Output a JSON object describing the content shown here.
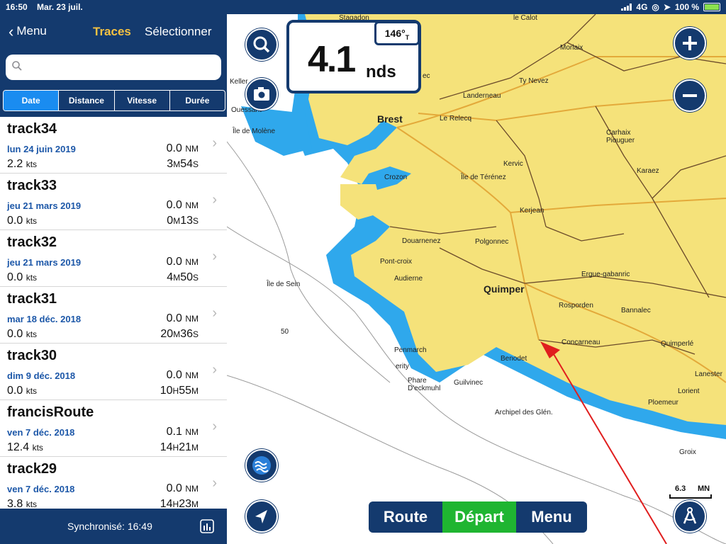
{
  "status_bar": {
    "time": "16:50",
    "date": "Mar. 23 juil.",
    "network": "4G",
    "battery": "100 %"
  },
  "nav": {
    "back_label": "Menu",
    "title": "Traces",
    "select_label": "Sélectionner"
  },
  "search": {
    "value": "",
    "placeholder": ""
  },
  "sort_tabs": [
    {
      "label": "Date",
      "active": true
    },
    {
      "label": "Distance",
      "active": false
    },
    {
      "label": "Vitesse",
      "active": false
    },
    {
      "label": "Durée",
      "active": false
    }
  ],
  "tracks": [
    {
      "name": "track34",
      "date": "lun 24 juin 2019",
      "dist": "0.0",
      "dist_unit": "NM",
      "speed": "2.2",
      "speed_unit": "kts",
      "dur_a": "3",
      "dur_a_unit": "M",
      "dur_b": "54",
      "dur_b_unit": "S"
    },
    {
      "name": "track33",
      "date": "jeu 21 mars 2019",
      "dist": "0.0",
      "dist_unit": "NM",
      "speed": "0.0",
      "speed_unit": "kts",
      "dur_a": "0",
      "dur_a_unit": "M",
      "dur_b": "13",
      "dur_b_unit": "S"
    },
    {
      "name": "track32",
      "date": "jeu 21 mars 2019",
      "dist": "0.0",
      "dist_unit": "NM",
      "speed": "0.0",
      "speed_unit": "kts",
      "dur_a": "4",
      "dur_a_unit": "M",
      "dur_b": "50",
      "dur_b_unit": "S"
    },
    {
      "name": "track31",
      "date": "mar 18 déc. 2018",
      "dist": "0.0",
      "dist_unit": "NM",
      "speed": "0.0",
      "speed_unit": "kts",
      "dur_a": "20",
      "dur_a_unit": "M",
      "dur_b": "36",
      "dur_b_unit": "S"
    },
    {
      "name": "track30",
      "date": "dim 9 déc. 2018",
      "dist": "0.0",
      "dist_unit": "NM",
      "speed": "0.0",
      "speed_unit": "kts",
      "dur_a": "10",
      "dur_a_unit": "H",
      "dur_b": "55",
      "dur_b_unit": "M"
    },
    {
      "name": "francisRoute",
      "date": "ven 7 déc. 2018",
      "dist": "0.1",
      "dist_unit": "NM",
      "speed": "12.4",
      "speed_unit": "kts",
      "dur_a": "14",
      "dur_a_unit": "H",
      "dur_b": "21",
      "dur_b_unit": "M"
    },
    {
      "name": "track29",
      "date": "ven 7 déc. 2018",
      "dist": "0.0",
      "dist_unit": "NM",
      "speed": "3.8",
      "speed_unit": "kts",
      "dur_a": "14",
      "dur_a_unit": "H",
      "dur_b": "23",
      "dur_b_unit": "M"
    }
  ],
  "footer": {
    "sync_label": "Synchronisé: 16:49"
  },
  "speed_display": {
    "value": "4.1",
    "unit": "nds",
    "heading": "146°",
    "heading_ref": "T"
  },
  "map_places": {
    "brest": "Brest",
    "quimper": "Quimper",
    "landerneau": "Landerneau",
    "ty_nevez": "Ty Nevez",
    "morlaix": "Morlaix",
    "le_relecq": "Le Relecq",
    "carhaix": "Carhaix\nPiouguer",
    "kervic": "Kervic",
    "crozon": "Crozon",
    "ile_de_terenez": "Île de Térénez",
    "karaez": "Karaez",
    "kerjean": "Kerjean",
    "douarnenez": "Douarnenez",
    "polgonnec": "Polgonnec",
    "pont_croix": "Pont-croix",
    "audierne": "Audierne",
    "ile_de_sein": "Île de Sein",
    "ile_de_molene": "Île de Molène",
    "ouessant": "Ouessant",
    "ergue": "Ergue-gabanric",
    "rosporden": "Rosporden",
    "bannalec": "Bannalec",
    "concarneau": "Concarneau",
    "quimperle": "Quimperlé",
    "penmarch": "Penmarch",
    "phare": "Phare\nD'eckmuhl",
    "guilvinec": "Guilvinec",
    "benodet": "Benodet",
    "archipel": "Archipel des Glén.",
    "lanester": "Lanester",
    "lorient": "Lorient",
    "ploemeur": "Ploemeur",
    "groix": "Groix",
    "depth_50": "50",
    "stagadon": "Stagadon",
    "le_calot": "le Calot",
    "kellen": "Keller",
    "ec": "ec",
    "erity": "erity"
  },
  "bottom_bar": {
    "route": "Route",
    "depart": "Départ",
    "menu": "Menu"
  },
  "scale": {
    "value": "6.3",
    "unit": "MN"
  },
  "colors": {
    "navy": "#143a6e",
    "accent_yellow": "#f6c242",
    "active_tab": "#1a8cf0",
    "land": "#f5e27a",
    "water_shallow": "#2fa8ec",
    "depart_green": "#1fb531",
    "track_red": "#e01e1e"
  }
}
